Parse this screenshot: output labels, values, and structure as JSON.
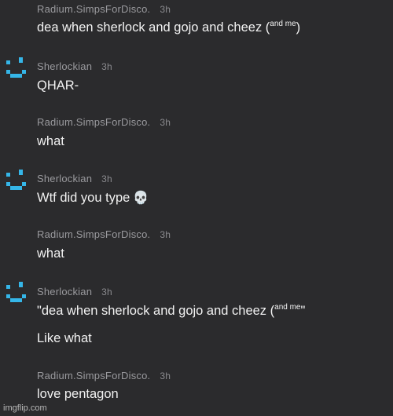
{
  "messages": [
    {
      "author": "Radium.SimpsForDisco.",
      "time": "3h",
      "text": "dea when sherlock and gojo and cheez (",
      "sup": "and me",
      "after": ")"
    },
    {
      "author": "Sherlockian",
      "time": "3h",
      "text": "QHAR-"
    },
    {
      "author": "Radium.SimpsForDisco.",
      "time": "3h",
      "text": "what"
    },
    {
      "author": "Sherlockian",
      "time": "3h",
      "text": "Wtf did you type",
      "emoji": "💀"
    },
    {
      "author": "Radium.SimpsForDisco.",
      "time": "3h",
      "text": "what"
    },
    {
      "author": "Sherlockian",
      "time": "3h",
      "text": "\"dea when sherlock and gojo and cheez (",
      "sup": "and me",
      "after": "\"",
      "text2": "Like what"
    },
    {
      "author": "Radium.SimpsForDisco.",
      "time": "3h",
      "text": "love pentagon"
    }
  ],
  "avatar_color": "#35b6e8",
  "watermark": "imgflip.com"
}
